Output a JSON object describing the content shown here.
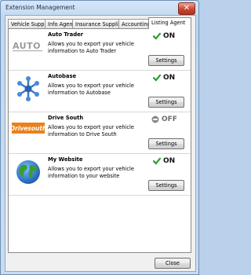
{
  "window": {
    "title": "Extension Management",
    "close_glyph": "✕"
  },
  "tabs": [
    {
      "label": "Vehicle Supplier",
      "active": false
    },
    {
      "label": "Info Agent",
      "active": false
    },
    {
      "label": "Insurance Supplier",
      "active": false
    },
    {
      "label": "Accounting",
      "active": false
    },
    {
      "label": "Listing Agent",
      "active": true
    }
  ],
  "extensions": [
    {
      "name": "Auto Trader",
      "description": "Allows you to export your vehicle information to Auto Trader",
      "status": "ON",
      "enabled": true,
      "logo": "auto-trader-logo",
      "logo_text": "AUTO",
      "settings_label": "Settings"
    },
    {
      "name": "Autobase",
      "description": "Allows you to export your vehicle information to Autobase",
      "status": "ON",
      "enabled": true,
      "logo": "autobase-logo",
      "settings_label": "Settings"
    },
    {
      "name": "Drive South",
      "description": "Allows you to export your vehicle information to Drive South",
      "status": "OFF",
      "enabled": false,
      "logo": "drive-south-logo",
      "logo_text": "Drivesouth",
      "settings_label": "Settings"
    },
    {
      "name": "My Website",
      "description": "Allows you to export your vehicle information to your website",
      "status": "ON",
      "enabled": true,
      "logo": "globe-icon",
      "settings_label": "Settings"
    }
  ],
  "footer": {
    "close_label": "Close"
  },
  "colors": {
    "on_green": "#2e9e2a",
    "off_gray": "#7a7a7a",
    "drive_south_orange": "#e8821e"
  }
}
